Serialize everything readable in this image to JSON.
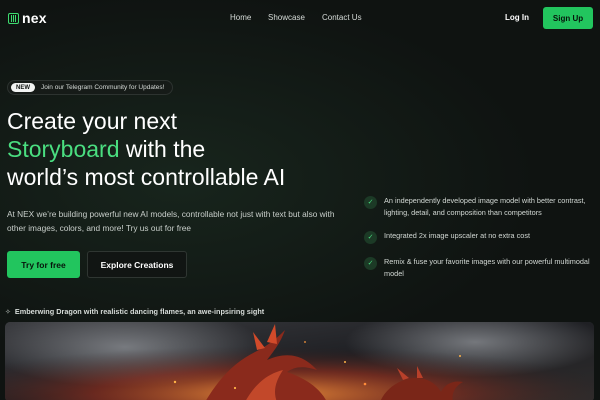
{
  "brand": {
    "name": "nex",
    "accent": "#22c55e"
  },
  "nav": {
    "links": [
      "Home",
      "Showcase",
      "Contact Us"
    ],
    "login": "Log In",
    "signup": "Sign Up"
  },
  "badge": {
    "tag": "NEW",
    "text": "Join our Telegram Community for Updates!"
  },
  "hero": {
    "title_line1": "Create your next",
    "title_accent": "Storyboard",
    "title_line2_rest": " with the",
    "title_line3": "world’s most controllable AI",
    "description": "At NEX we’re building powerful new AI models, controllable not just with text but also with other images, colors, and more! Try us out for free",
    "primary_button": "Try for free",
    "secondary_button": "Explore Creations"
  },
  "features": [
    {
      "icon": "check-icon",
      "text": "An independently developed image model with better contrast, lighting, detail, and composition than competitors"
    },
    {
      "icon": "check-icon",
      "text": "Integrated 2x image upscaler at no extra cost"
    },
    {
      "icon": "check-icon",
      "text": "Remix & fuse your favorite images with our powerful multimodal model"
    }
  ],
  "showcase": {
    "icon": "sparkle-icon",
    "caption": "Emberwing Dragon with realistic dancing flames, an awe-inpsiring sight"
  }
}
